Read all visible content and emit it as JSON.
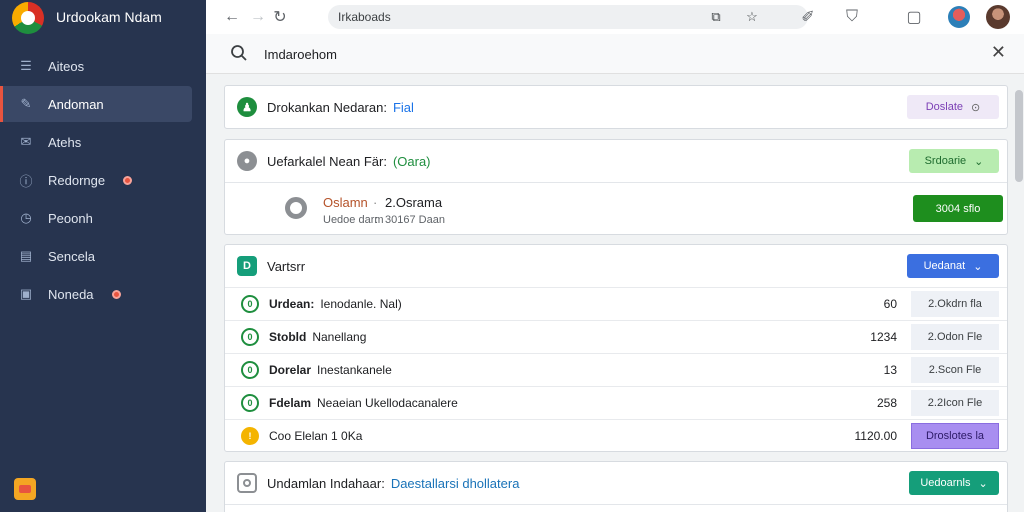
{
  "app": {
    "title": "Urdookam Ndam"
  },
  "sidebar": {
    "items": [
      {
        "label": "Aiteos",
        "icon": "menu-icon",
        "active": false,
        "badge": false
      },
      {
        "label": "Andoman",
        "icon": "edit-icon",
        "active": true,
        "badge": false
      },
      {
        "label": "Atehs",
        "icon": "mail-icon",
        "active": false,
        "badge": false
      },
      {
        "label": "Redornge",
        "icon": "info-icon",
        "active": false,
        "badge": true
      },
      {
        "label": "Peoonh",
        "icon": "clock-icon",
        "active": false,
        "badge": false
      },
      {
        "label": "Sencela",
        "icon": "list-icon",
        "active": false,
        "badge": false
      },
      {
        "label": "Noneda",
        "icon": "inbox-icon",
        "active": false,
        "badge": true
      }
    ],
    "footer_icon": "calendar-icon"
  },
  "toolbar": {
    "address": "Irkaboads"
  },
  "search": {
    "value": "Imdaroehom"
  },
  "cards": {
    "card1": {
      "title": "Drokankan Nedaran:",
      "highlight": "Fial",
      "button": "Doslate"
    },
    "card2": {
      "title": "Uefarkalel Nean Fär:",
      "highlight": "(Oara)",
      "button": "Srdoarie",
      "detail_left_top": "Oslamn",
      "detail_sep": "·",
      "detail_right_top": "2.Osrama",
      "detail_left_bottom": "Uedoe darm",
      "detail_sep_bottom": ":",
      "detail_right_bottom": "30167 Daan",
      "action": "3004 sflo"
    },
    "card3": {
      "title": "Vartsrr",
      "button": "Uedanat",
      "rows": [
        {
          "title": "Urdean:",
          "desc": "Ienodanle. Nal)",
          "value": "60",
          "cell": "2.Okdrn fla"
        },
        {
          "title": "Stobld",
          "desc": "Nanellang",
          "value": "1234",
          "cell": "2.Odon Fle"
        },
        {
          "title": "Dorelar",
          "desc": "Inestankanele",
          "value": "13",
          "cell": "2.Scon Fle"
        },
        {
          "title": "Fdelam",
          "desc": "Neaeian Ukellodacanalere",
          "value": "258",
          "cell": "2.2Icon Fle"
        },
        {
          "title": "",
          "desc": "Coo Elelan 1 0Ka",
          "value": "1120.00",
          "cell": "Droslotes la"
        }
      ]
    },
    "card4": {
      "title": "Undamlan Indahaar:",
      "highlight": "Daestallarsi dhollatera",
      "button": "Uedoarnls"
    }
  },
  "colors": {
    "sidebar_bg": "#27344f",
    "accent_red": "#e8543f",
    "green": "#1e8e3e",
    "blue": "#3b6fe0",
    "purple_cell": "#a88ef0",
    "teal": "#159e7a"
  }
}
